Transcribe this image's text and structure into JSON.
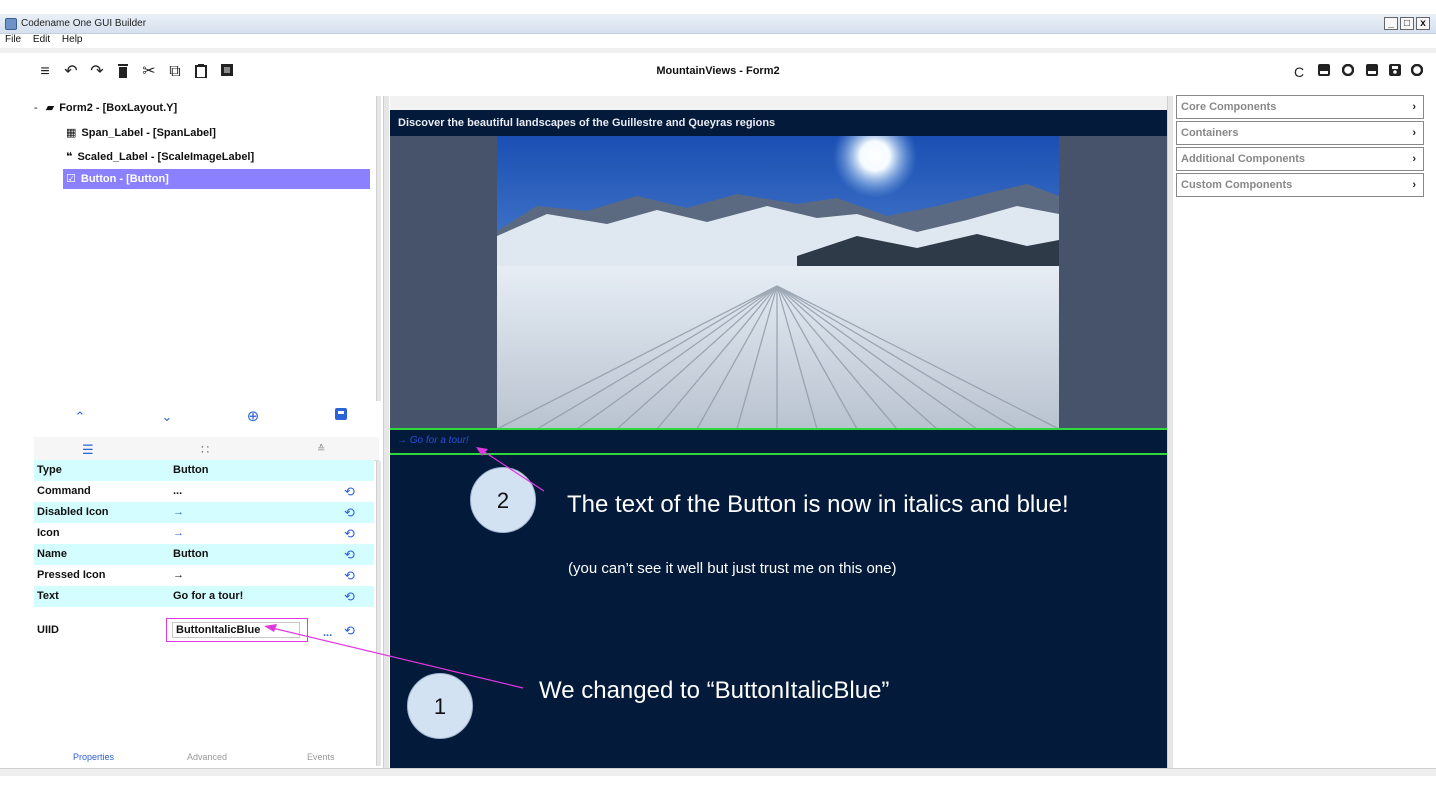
{
  "window": {
    "title": "Codename One GUI Builder",
    "controls": [
      "_",
      "□",
      "x"
    ]
  },
  "menu": [
    "File",
    "Edit",
    "Help"
  ],
  "toolbar": {
    "left_icons": [
      "menu-icon",
      "undo-icon",
      "redo-icon",
      "delete-icon",
      "cut-icon",
      "copy-icon",
      "paste-icon",
      "stop-icon"
    ],
    "right_icons": [
      "refresh-icon",
      "image-icon",
      "preview-icon",
      "image2-icon",
      "save-icon",
      "run-icon"
    ],
    "document_title": "MountainViews - Form2"
  },
  "tree": {
    "root": "Form2 - [BoxLayout.Y]",
    "children": [
      "Span_Label - [SpanLabel]",
      "Scaled_Label - [ScaleImageLabel]",
      "Button - [Button]"
    ]
  },
  "property_tabs": [
    "Properties",
    "Advanced",
    "Events"
  ],
  "properties": [
    {
      "name": "Type",
      "value": "Button"
    },
    {
      "name": "Command",
      "value": "..."
    },
    {
      "name": "Disabled Icon",
      "value": "→"
    },
    {
      "name": "Icon",
      "value": "→"
    },
    {
      "name": "Name",
      "value": "Button"
    },
    {
      "name": "Pressed Icon",
      "value": "→"
    },
    {
      "name": "Text",
      "value": "Go for a tour!"
    }
  ],
  "uiid": {
    "name": "UIID",
    "value": "ButtonItalicBlue",
    "more": "..."
  },
  "canvas": {
    "header": "Discover the beautiful landscapes of the Guillestre and Queyras regions",
    "button_text": "→ Go for a tour!"
  },
  "callouts": {
    "one": {
      "number": "1",
      "text": "We changed to “ButtonItalicBlue”"
    },
    "two": {
      "number": "2",
      "text": "The text of the Button is now in italics and blue!",
      "subtext": "(you can’t see it well but just trust me on this one)"
    }
  },
  "palette": [
    "Core Components",
    "Containers",
    "Additional Components",
    "Custom Components"
  ],
  "colors": {
    "selection": "#8b80ff",
    "canvas_bg": "#031a3a",
    "highlight_green": "#2ed83a",
    "annotation_magenta": "#e037e0",
    "row_alt": "#d4fdff"
  }
}
